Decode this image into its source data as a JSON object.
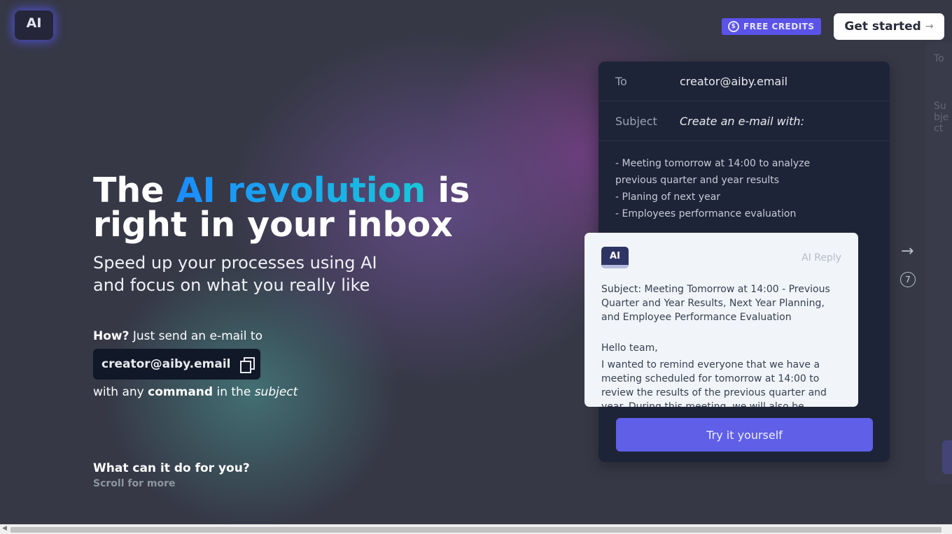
{
  "header": {
    "logo": "AI",
    "credits_label": "FREE CREDITS",
    "credits_icon": "coin-icon",
    "get_started": "Get started",
    "get_started_arrow": "→"
  },
  "hero": {
    "title_pre": "The ",
    "title_highlight": "AI revolution",
    "title_post": " is right in your inbox",
    "subtitle": "Speed up your processes using AI and focus on what you really like",
    "how_bold": "How?",
    "how_text": " Just send an e-mail to",
    "email": "creator@aiby.email",
    "with_pre": "with any ",
    "with_bold": "command",
    "with_mid": " in the ",
    "with_italic": "subject",
    "what": "What can it do for you?",
    "scroll": "Scroll for more"
  },
  "card": {
    "to_label": "To",
    "to_value": "creator@aiby.email",
    "subject_label": "Subject",
    "subject_value": "Create an e-mail with:",
    "items": [
      "- Meeting tomorrow at 14:00 to analyze previous quarter and year results",
      "- Planing of next year",
      "- Employees performance evaluation"
    ],
    "reply": {
      "logo": "AI",
      "label": "AI Reply",
      "subject": "Subject: Meeting Tomorrow at 14:00 - Previous Quarter and Year Results, Next Year Planning, and Employee Performance Evaluation",
      "greeting": "Hello team,",
      "body": "I wanted to remind everyone that we have a meeting scheduled for tomorrow at 14:00 to review the results of the previous quarter and year. During this meeting, we will also be"
    },
    "try_button": "Try it yourself"
  },
  "carousel": {
    "next_arrow": "→",
    "count": "7"
  },
  "ghost_card": {
    "to_label": "To",
    "subject_label": "Subject"
  },
  "colors": {
    "accent": "#5f5fe8",
    "credits": "#5b53e8",
    "card_bg": "#1e2437"
  }
}
